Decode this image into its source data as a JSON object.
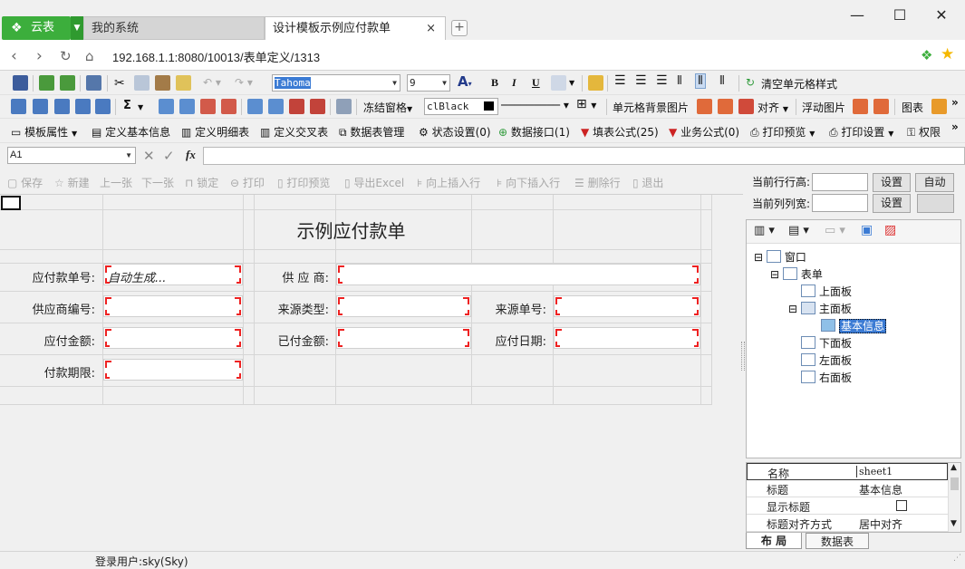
{
  "browser": {
    "tabs": [
      "云表",
      "我的系统",
      "设计模板示例应付款单"
    ],
    "close_tab": "×",
    "add_tab": "+",
    "window_controls": [
      "—",
      "☐",
      "✕"
    ],
    "url": "192.168.1.1:8080/10013/表单定义/1313"
  },
  "toolbar1": {
    "font_name": "Tahoma",
    "font_size": "9",
    "bold": "B",
    "italic": "I",
    "underline": "U",
    "clear_style": "清空单元格样式"
  },
  "toolbar2": {
    "sigma": "Σ",
    "freeze": "冻结窗格",
    "color_name": "clBlack",
    "cell_bg_image": "单元格背景图片",
    "align": "对齐",
    "float_image": "浮动图片",
    "chart": "图表"
  },
  "toolbar3": {
    "items": [
      "模板属性",
      "定义基本信息",
      "定义明细表",
      "定义交叉表",
      "数据表管理",
      "状态设置(0)",
      "数据接口(1)",
      "填表公式(25)",
      "业务公式(0)",
      "打印预览",
      "打印设置",
      "权限"
    ]
  },
  "formula_bar": {
    "cell_ref": "A1",
    "fx": "fx"
  },
  "action_bar": {
    "items": [
      "保存",
      "新建",
      "上一张",
      "下一张",
      "锁定",
      "打印",
      "打印预览",
      "导出Excel",
      "向上插入行",
      "向下插入行",
      "删除行",
      "退出"
    ]
  },
  "form": {
    "title": "示例应付款单",
    "fields": [
      {
        "label": "应付款单号:",
        "value": "自动生成..."
      },
      {
        "label": "供 应 商:",
        "value": ""
      },
      {
        "label": "供应商编号:",
        "value": ""
      },
      {
        "label": "来源类型:",
        "value": ""
      },
      {
        "label": "来源单号:",
        "value": ""
      },
      {
        "label": "应付金额:",
        "value": ""
      },
      {
        "label": "已付金额:",
        "value": ""
      },
      {
        "label": "应付日期:",
        "value": ""
      },
      {
        "label": "付款期限:",
        "value": ""
      }
    ]
  },
  "right_panel": {
    "row_height_label": "当前行行高:",
    "col_width_label": "当前列列宽:",
    "set_button": "设置",
    "auto_button": "自动",
    "tree": [
      "窗口",
      "表单",
      "上面板",
      "主面板",
      "基本信息",
      "下面板",
      "左面板",
      "右面板"
    ],
    "props": [
      {
        "key": "名称",
        "value": "sheet1"
      },
      {
        "key": "标题",
        "value": "基本信息"
      },
      {
        "key": "显示标题",
        "value": ""
      },
      {
        "key": "标题对齐方式",
        "value": "居中对齐"
      }
    ],
    "tabs": [
      "布 局",
      "数据表"
    ]
  },
  "status": {
    "user": "登录用户:sky(Sky)"
  },
  "colors": {
    "brand_green": "#3cae3c",
    "required_corner": "#e22222",
    "selection": "#3b7bd4"
  }
}
